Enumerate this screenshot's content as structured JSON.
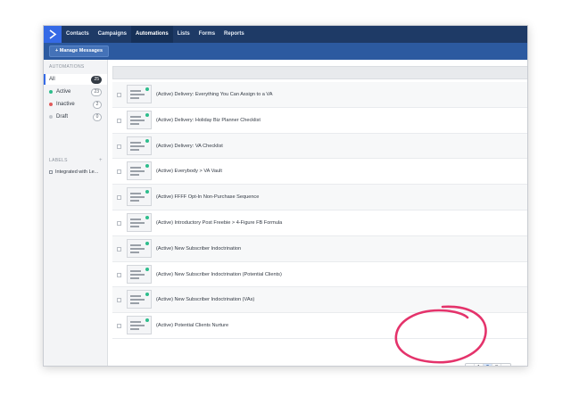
{
  "nav": {
    "items": [
      {
        "label": "Contacts",
        "active": false
      },
      {
        "label": "Campaigns",
        "active": false
      },
      {
        "label": "Automations",
        "active": true
      },
      {
        "label": "Lists",
        "active": false
      },
      {
        "label": "Forms",
        "active": false
      },
      {
        "label": "Reports",
        "active": false
      }
    ]
  },
  "subnav": {
    "manage_label": "+ Manage Messages"
  },
  "sidebar": {
    "heading": "AUTOMATIONS",
    "filters": [
      {
        "label": "All",
        "count": "25",
        "dot": "",
        "active": true
      },
      {
        "label": "Active",
        "count": "23",
        "dot": "#2ebd8c",
        "active": false
      },
      {
        "label": "Inactive",
        "count": "2",
        "dot": "#e05a5a",
        "active": false
      },
      {
        "label": "Draft",
        "count": "0",
        "dot": "#c3c7cd",
        "active": false
      }
    ],
    "labels_heading": "LABELS",
    "labels_add": "+",
    "label_item": "Integrated with Le..."
  },
  "automations": [
    "(Active) Delivery: Everything You Can Assign to a VA",
    "(Active) Delivery: Holiday Biz Planner Checklist",
    "(Active) Delivery: VA Checklist",
    "(Active) Everybody > VA Vault",
    "(Active) FFFF Opt-In Non-Purchase Sequence",
    "(Active) Introductory Post Freebie > 4-Figure FB Formula",
    "(Active) New Subscriber Indoctrination",
    "(Active) New Subscriber Indoctrination (Potential Clients)",
    "(Active) New Subscriber Indoctrination (VAs)",
    "(Active) Potential Clients Nurture"
  ],
  "pagination": {
    "prev": "‹",
    "pages": [
      "1",
      "2",
      "3"
    ],
    "current": "2",
    "next": "›"
  },
  "colors": {
    "nav_bg": "#1e3a66",
    "subnav_bg": "#2c5aa0",
    "accent": "#356ae6",
    "active_status": "#2ebd8c",
    "annotation": "#e4336b"
  }
}
